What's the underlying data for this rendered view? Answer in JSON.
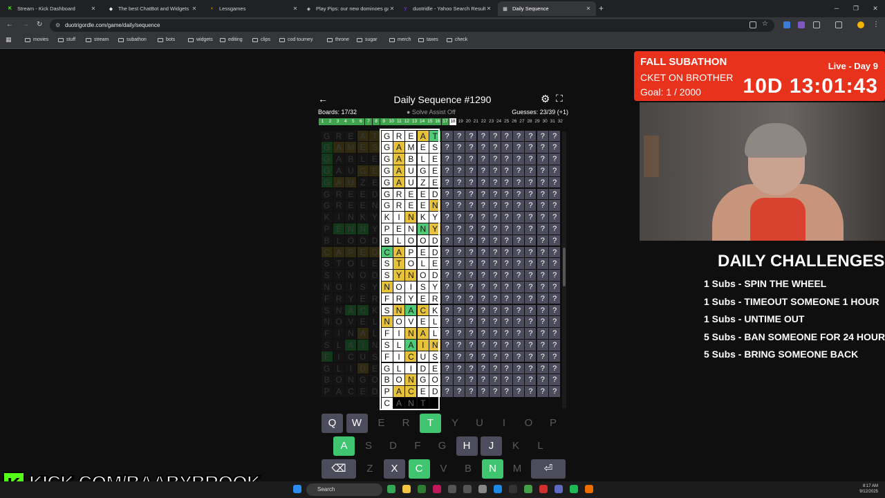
{
  "browser": {
    "tabs": [
      {
        "label": "Stream - Kick Dashboard",
        "fav": "K",
        "favcolor": "#53fc18"
      },
      {
        "label": "The best ChatBot and Widgets",
        "fav": "◆",
        "favcolor": "#eeeeee"
      },
      {
        "label": "Lessgames",
        "fav": "‹",
        "favcolor": "#f0b000"
      },
      {
        "label": "Play Pips: our new dominoes ga...",
        "fav": "◈",
        "favcolor": "#dddddd"
      },
      {
        "label": "duotridle - Yahoo Search Results",
        "fav": "y",
        "favcolor": "#7e1fff"
      },
      {
        "label": "Daily Sequence",
        "fav": "▦",
        "favcolor": "#dddddd"
      }
    ],
    "url": "duotrigordle.com/game/daily/sequence",
    "bookmarks": [
      "movies",
      "stuff",
      "stream",
      "subathon",
      "bots",
      "widgets",
      "editing",
      "clips",
      "cod tourney",
      "throne",
      "sugar",
      "merch",
      "taxes",
      "check"
    ]
  },
  "game": {
    "title": "Daily Sequence #1290",
    "boards": "Boards: 17/32",
    "assist": "● Solve Assist Off",
    "guesses": "Guesses: 23/39 (+1)",
    "board_numbers": [
      "1",
      "2",
      "3",
      "4",
      "5",
      "6",
      "7",
      "8",
      "9",
      "10",
      "11",
      "12",
      "13",
      "14",
      "15",
      "16",
      "17",
      "18",
      "19",
      "20",
      "21",
      "22",
      "23",
      "24",
      "25",
      "26",
      "27",
      "28",
      "29",
      "30",
      "31",
      "32"
    ],
    "solved_count": 17,
    "current_board": 18,
    "left_column": [
      "GREAT",
      "GAMES",
      "GABLE",
      "GAUGE",
      "GAUZE",
      "GREED",
      "GREEN",
      "KINKY",
      "PENNY",
      "BLOOD",
      "CAPED",
      "STOLE",
      "SYNOD",
      "NOISY",
      "FRYER",
      "SNACK",
      "NOVEL",
      "FINAL",
      "SLAIN",
      "FICUS",
      "GLIDE",
      "BONGO",
      "PACED"
    ],
    "left_colors": [
      "nnnyy",
      "gyyyy",
      "gnnnn",
      "gnnyy",
      "gyynn",
      "nnnnn",
      "nnnnn",
      "nnnnn",
      "ngggn",
      "nnnnn",
      "yyyyy",
      "nnnnn",
      "nnnnn",
      "nnnnn",
      "nnnnn",
      "nnggn",
      "nnnnn",
      "nnnyn",
      "nnggn",
      "gnnnn",
      "nnnyn",
      "nnnnn",
      "nnnnn"
    ],
    "active_column": [
      "GREAT",
      "GAMES",
      "GABLE",
      "GAUGE",
      "GAUZE",
      "GREED",
      "GREEN",
      "KINKY",
      "PENNY",
      "BLOOD",
      "CAPED",
      "STOLE",
      "SYNOD",
      "NOISY",
      "FRYER",
      "SNACK",
      "NOVEL",
      "FINAL",
      "SLAIN",
      "FICUS",
      "GLIDE",
      "BONGO",
      "PACED",
      "CANT"
    ],
    "active_colors": [
      "nnnyg",
      "nynnn",
      "nynnn",
      "nynnn",
      "nynnn",
      "nnnnn",
      "nnnny",
      "nnynn",
      "nnngy",
      "nnnnn",
      "gynnn",
      "nynnn",
      "nyynn",
      "ynnnn",
      "nnnnn",
      "nygyn",
      "ynnnn",
      "nnyyn",
      "nngyy",
      "nnynn",
      "nnnnn",
      "nnynn",
      "nyynn",
      "neeee"
    ],
    "hidden_rows": 23,
    "keyboard": {
      "row1": [
        {
          "k": "Q",
          "s": "u"
        },
        {
          "k": "W",
          "s": "u"
        },
        {
          "k": "E",
          "s": "d"
        },
        {
          "k": "R",
          "s": "d"
        },
        {
          "k": "T",
          "s": "g"
        },
        {
          "k": "Y",
          "s": "d"
        },
        {
          "k": "U",
          "s": "d"
        },
        {
          "k": "I",
          "s": "d"
        },
        {
          "k": "O",
          "s": "d"
        },
        {
          "k": "P",
          "s": "d"
        }
      ],
      "row2": [
        {
          "k": "A",
          "s": "g"
        },
        {
          "k": "S",
          "s": "d"
        },
        {
          "k": "D",
          "s": "d"
        },
        {
          "k": "F",
          "s": "d"
        },
        {
          "k": "G",
          "s": "d"
        },
        {
          "k": "H",
          "s": "u"
        },
        {
          "k": "J",
          "s": "u"
        },
        {
          "k": "K",
          "s": "d"
        },
        {
          "k": "L",
          "s": "d"
        }
      ],
      "row3": [
        {
          "k": "⌫",
          "s": "w"
        },
        {
          "k": "Z",
          "s": "d"
        },
        {
          "k": "X",
          "s": "u"
        },
        {
          "k": "C",
          "s": "g"
        },
        {
          "k": "V",
          "s": "d"
        },
        {
          "k": "B",
          "s": "d"
        },
        {
          "k": "N",
          "s": "g"
        },
        {
          "k": "M",
          "s": "d"
        },
        {
          "k": "⏎",
          "s": "w"
        }
      ]
    }
  },
  "overlay": {
    "subathon_title": "FALL SUBATHON",
    "subathon_scroll": "CKET ON BROTHER",
    "goal": "Goal: 1 / 2000",
    "live": "Live - Day 9",
    "timer": "10D 13:01:43",
    "challenges_title": "DAILY CHALLENGES",
    "challenges": [
      "1 Subs - SPIN THE WHEEL",
      "1 Subs - TIMEOUT SOMEONE 1 HOUR",
      "1 Subs - UNTIME OUT",
      "5 Subs - BAN SOMEONE FOR 24 HOURS",
      "5 Subs - BRING SOMEONE BACK"
    ],
    "kick_url": "KICK.COM/BAABYBROOK"
  },
  "taskbar": {
    "search": "Search",
    "time": "8:17 AM",
    "date": "9/12/2025"
  }
}
